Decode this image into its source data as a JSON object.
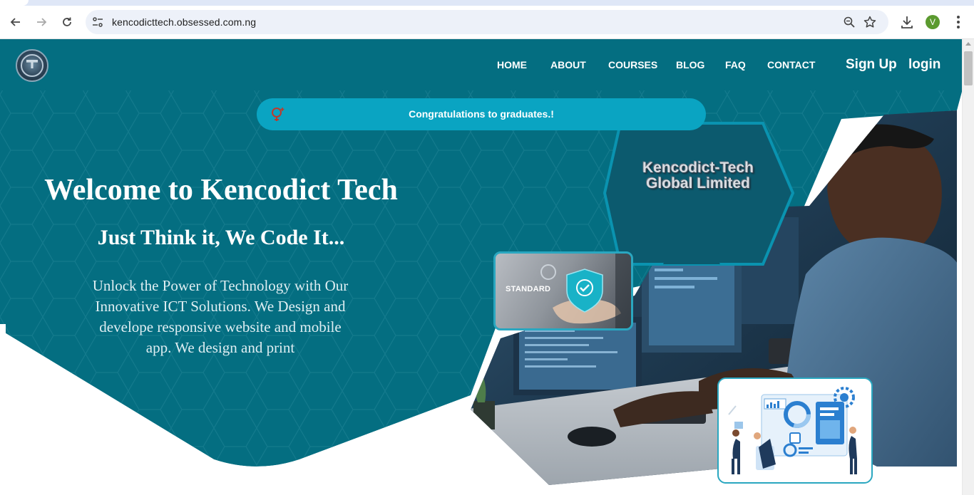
{
  "browser": {
    "url": "kencodicttech.obsessed.com.ng",
    "profile_initial": "V"
  },
  "nav": {
    "items": [
      "HOME",
      "ABOUT",
      "COURSES",
      "BLOG",
      "FAQ",
      "CONTACT"
    ],
    "sign_up": "Sign Up",
    "login": "login"
  },
  "announcement": {
    "text": "Congratulations to graduates.!"
  },
  "hero": {
    "title": "Welcome to Kencodict Tech",
    "tagline": "Just Think it, We Code It...",
    "description": "Unlock the Power of Technology with Our Innovative ICT Solutions. We Design and develope responsive website and mobile app. We design and print"
  },
  "visuals": {
    "company_name_line1": "Kencodict-Tech",
    "company_name_line2": "Global Limited",
    "standard_label": "STANDARD"
  },
  "colors": {
    "hero_teal": "#046e81",
    "banner_cyan": "#0aa4c2",
    "accent_border": "#2aa7c0"
  }
}
